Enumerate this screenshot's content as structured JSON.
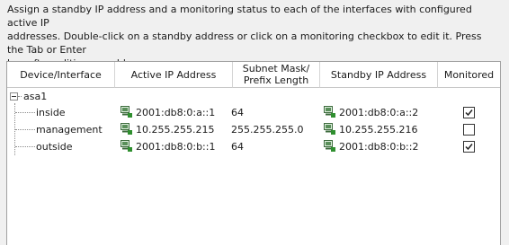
{
  "instructions": {
    "line1": "Assign a standby IP address and a monitoring status to each of the interfaces with configured active IP",
    "line2": "addresses. Double-click on a standby address or click on a monitoring checkbox to edit it. Press the Tab or Enter",
    "line3": "key after editing an address."
  },
  "table": {
    "headers": {
      "device": "Device/Interface",
      "active_ip": "Active IP Address",
      "subnet_line1": "Subnet Mask/",
      "subnet_line2": "Prefix Length",
      "standby_ip": "Standby IP Address",
      "monitored": "Monitored"
    },
    "root": {
      "name": "asa1",
      "expanded": true
    },
    "rows": [
      {
        "name": "inside",
        "active_ip": "2001:db8:0:a::1",
        "subnet": "64",
        "standby_ip": "2001:db8:0:a::2",
        "monitored": true
      },
      {
        "name": "management",
        "active_ip": "10.255.255.215",
        "subnet": "255.255.255.0",
        "standby_ip": "10.255.255.216",
        "monitored": false
      },
      {
        "name": "outside",
        "active_ip": "2001:db8:0:b::1",
        "subnet": "64",
        "standby_ip": "2001:db8:0:b::2",
        "monitored": true
      }
    ]
  },
  "icons": {
    "ip": "network-computer-icon",
    "tree": "collapse-minus-icon"
  }
}
